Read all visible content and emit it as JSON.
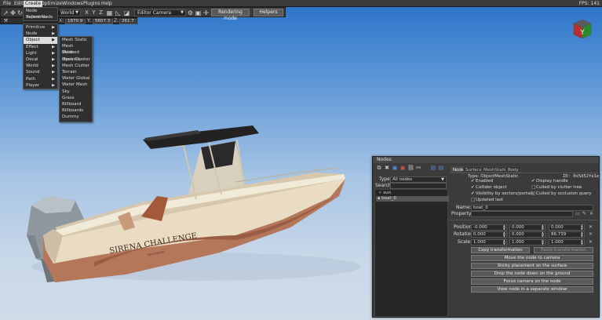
{
  "menubar": {
    "items": [
      "File",
      "Edit",
      "Create",
      "Optimize",
      "Windows",
      "Plugins",
      "Help"
    ],
    "active": "Create",
    "fps": "FPS: 141"
  },
  "toolbar": {
    "space_combo": "World",
    "axis_x": "X",
    "axis_y": "Y",
    "axis_z": "Z",
    "camera_combo": "Editor Camera",
    "rendering_mode": "Rendering mode",
    "helpers": "Helpers"
  },
  "coordbar": {
    "x_label": "X:",
    "x_value": "1870.9",
    "y_label": "Y:",
    "y_value": "5607.3",
    "z_label": "Z:",
    "z_value": "261.7"
  },
  "create_menu": {
    "items": [
      {
        "label": "Node Reference",
        "sub": false
      },
      {
        "label": "Import Node",
        "sub": false
      }
    ],
    "group": [
      {
        "label": "Primitive",
        "sub": true
      },
      {
        "label": "Node",
        "sub": true
      },
      {
        "label": "Object",
        "sub": true
      },
      {
        "label": "Effect",
        "sub": true
      },
      {
        "label": "Light",
        "sub": true
      },
      {
        "label": "Decal",
        "sub": true
      },
      {
        "label": "World",
        "sub": true
      },
      {
        "label": "Sound",
        "sub": true
      },
      {
        "label": "Path",
        "sub": true
      },
      {
        "label": "Player",
        "sub": true
      }
    ],
    "selected": "Object"
  },
  "object_submenu": {
    "items": [
      "Mesh Static",
      "Mesh Skinned",
      "Mesh Dynamic",
      "Mesh Cluster",
      "Mesh Clutter",
      "Terrain",
      "Water Global",
      "Water Mesh",
      "Sky",
      "Grass",
      "Billboard",
      "Billboards",
      "Dummy"
    ]
  },
  "scene": {
    "boat_name_text": "SIRENA CHALLENGE",
    "boat_sub_text": "sea master"
  },
  "gizmo": {
    "label": "Y"
  },
  "nodes_panel": {
    "title": "Nodes",
    "type_label": "Type:",
    "type_value": "All nodes",
    "search_label": "Search:",
    "tree": [
      {
        "label": "sun",
        "selected": false
      },
      {
        "label": "boat_0",
        "selected": true
      }
    ],
    "tabs": [
      "Node",
      "Surfaces",
      "MeshStatic",
      "Body"
    ],
    "active_tab": "Node",
    "object_type": "Type: ObjectMeshStatic",
    "object_id": "ID: 0x5d52fe1e",
    "checks_left": [
      {
        "label": "Enabled",
        "checked": true
      },
      {
        "label": "Collider object",
        "checked": true
      },
      {
        "label": "Visibility by sectors/portals",
        "checked": true
      },
      {
        "label": "Updated last",
        "checked": false
      }
    ],
    "checks_right": [
      {
        "label": "Display handle",
        "checked": true
      },
      {
        "label": "Culled by clutter tree",
        "checked": false
      },
      {
        "label": "Culled by occlusion query",
        "checked": false
      }
    ],
    "name_label": "Name:",
    "name_value": "boat_0",
    "property_label": "Property:",
    "property_value": "",
    "position_label": "Position:",
    "position": [
      "-0.000",
      "0.000",
      "0.000"
    ],
    "rotation_label": "Rotation:",
    "rotation": [
      "0.000",
      "0.000",
      "86.739"
    ],
    "scale_label": "Scale:",
    "scale": [
      "1.000",
      "1.000",
      "1.000"
    ],
    "copy_btn": "Copy transformation",
    "paste_btn": "Paste transformation",
    "actions": [
      "Move the node to camera",
      "Sticky placement on the surface",
      "Drop the node down on the ground",
      "Focus camera on the node",
      "View node in a separate window"
    ]
  }
}
